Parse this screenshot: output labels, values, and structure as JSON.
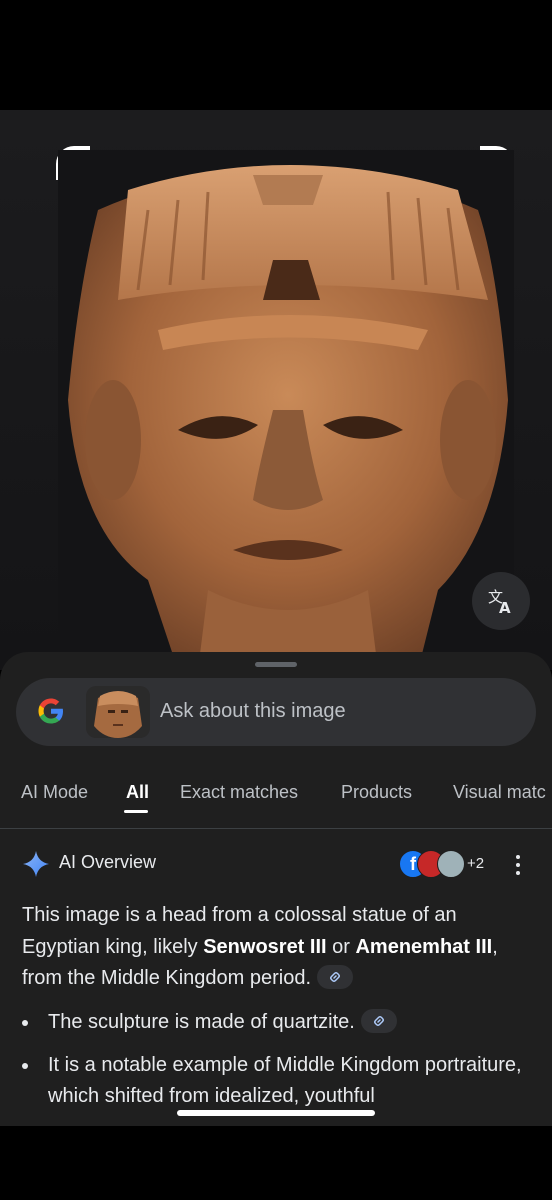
{
  "search": {
    "placeholder": "Ask about this image",
    "logo_icon": "google-g-icon",
    "thumbnail": "statue-head-thumbnail"
  },
  "viewer": {
    "translate_icon": "translate-icon",
    "image": "egyptian-quartzite-head"
  },
  "tabs": [
    {
      "label": "AI Mode"
    },
    {
      "label": "All",
      "active": true
    },
    {
      "label": "Exact matches"
    },
    {
      "label": "Products"
    },
    {
      "label": "Visual matc"
    }
  ],
  "ai_overview": {
    "title": "AI Overview",
    "sources_more": "+2",
    "intro_before": "This image is a head from a colossal statue of an Egyptian king, likely ",
    "king1": "Senwosret III",
    "conj": " or ",
    "king2": "Amenemhat III",
    "intro_after": ", from the Middle Kingdom period.",
    "bullets": [
      "The sculpture is made of quartzite.",
      "It is a notable example of Middle Kingdom portraiture, which shifted from idealized, youthful"
    ]
  },
  "colors": {
    "sheet_bg": "#1f1f1f",
    "search_bg": "#303134",
    "text": "#e8eaed",
    "facebook": "#1877f2"
  }
}
